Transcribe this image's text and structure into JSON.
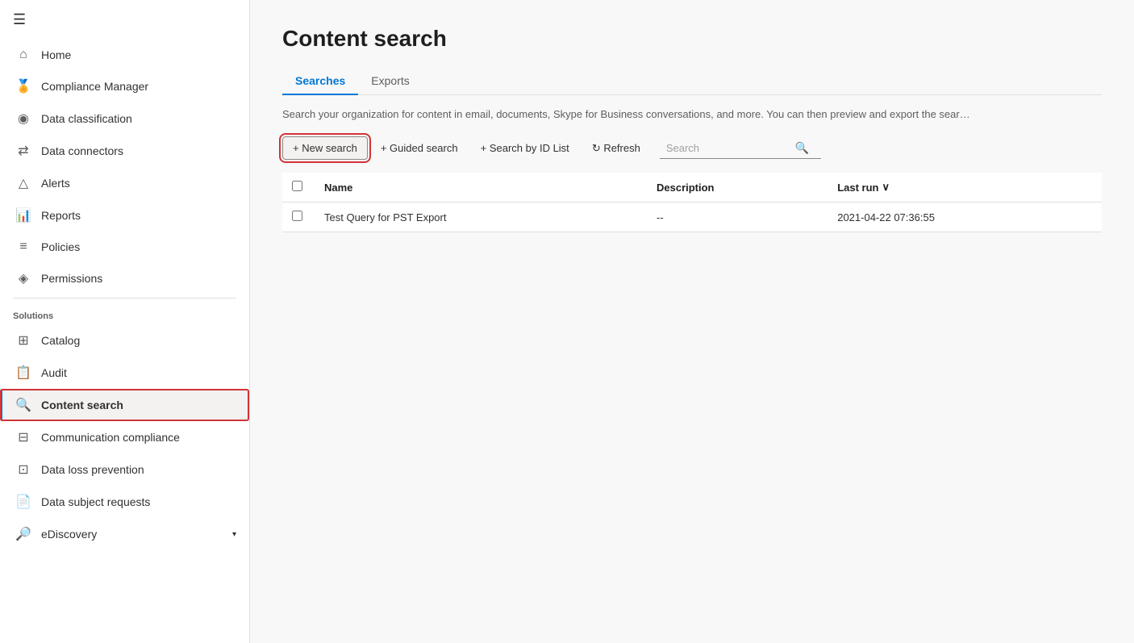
{
  "app": {
    "title": "Content search"
  },
  "sidebar": {
    "hamburger_label": "☰",
    "items": [
      {
        "id": "home",
        "label": "Home",
        "icon": "⌂",
        "active": false
      },
      {
        "id": "compliance-manager",
        "label": "Compliance Manager",
        "icon": "🏆",
        "active": false
      },
      {
        "id": "data-classification",
        "label": "Data classification",
        "icon": "◎",
        "active": false
      },
      {
        "id": "data-connectors",
        "label": "Data connectors",
        "icon": "⇌",
        "active": false
      },
      {
        "id": "alerts",
        "label": "Alerts",
        "icon": "△",
        "active": false
      },
      {
        "id": "reports",
        "label": "Reports",
        "icon": "📈",
        "active": false
      },
      {
        "id": "policies",
        "label": "Policies",
        "icon": "☰",
        "active": false
      },
      {
        "id": "permissions",
        "label": "Permissions",
        "icon": "◈",
        "active": false
      }
    ],
    "solutions_label": "Solutions",
    "solutions_items": [
      {
        "id": "catalog",
        "label": "Catalog",
        "icon": "⊞",
        "active": false
      },
      {
        "id": "audit",
        "label": "Audit",
        "icon": "📋",
        "active": false
      },
      {
        "id": "content-search",
        "label": "Content search",
        "icon": "🔍",
        "active": true,
        "highlighted": true
      },
      {
        "id": "communication-compliance",
        "label": "Communication compliance",
        "icon": "⊟",
        "active": false
      },
      {
        "id": "data-loss-prevention",
        "label": "Data loss prevention",
        "icon": "⊡",
        "active": false
      },
      {
        "id": "data-subject-requests",
        "label": "Data subject requests",
        "icon": "⊞",
        "active": false
      },
      {
        "id": "eDiscovery",
        "label": "eDiscovery",
        "icon": "⊟",
        "active": false,
        "expandable": true
      }
    ]
  },
  "main": {
    "title": "Content search",
    "tabs": [
      {
        "id": "searches",
        "label": "Searches",
        "active": true
      },
      {
        "id": "exports",
        "label": "Exports",
        "active": false
      }
    ],
    "description": "Search your organization for content in email, documents, Skype for Business conversations, and more. You can then preview and export the sear…",
    "toolbar": {
      "new_search_label": "+ New search",
      "guided_search_label": "+ Guided search",
      "search_by_id_label": "+ Search by ID List",
      "refresh_label": "↻ Refresh",
      "search_placeholder": "Search"
    },
    "table": {
      "columns": [
        {
          "id": "name",
          "label": "Name"
        },
        {
          "id": "description",
          "label": "Description"
        },
        {
          "id": "last_run",
          "label": "Last run",
          "sortable": true
        }
      ],
      "rows": [
        {
          "name": "Test Query for PST Export",
          "description": "--",
          "last_run": "2021-04-22 07:36:55"
        }
      ]
    }
  }
}
